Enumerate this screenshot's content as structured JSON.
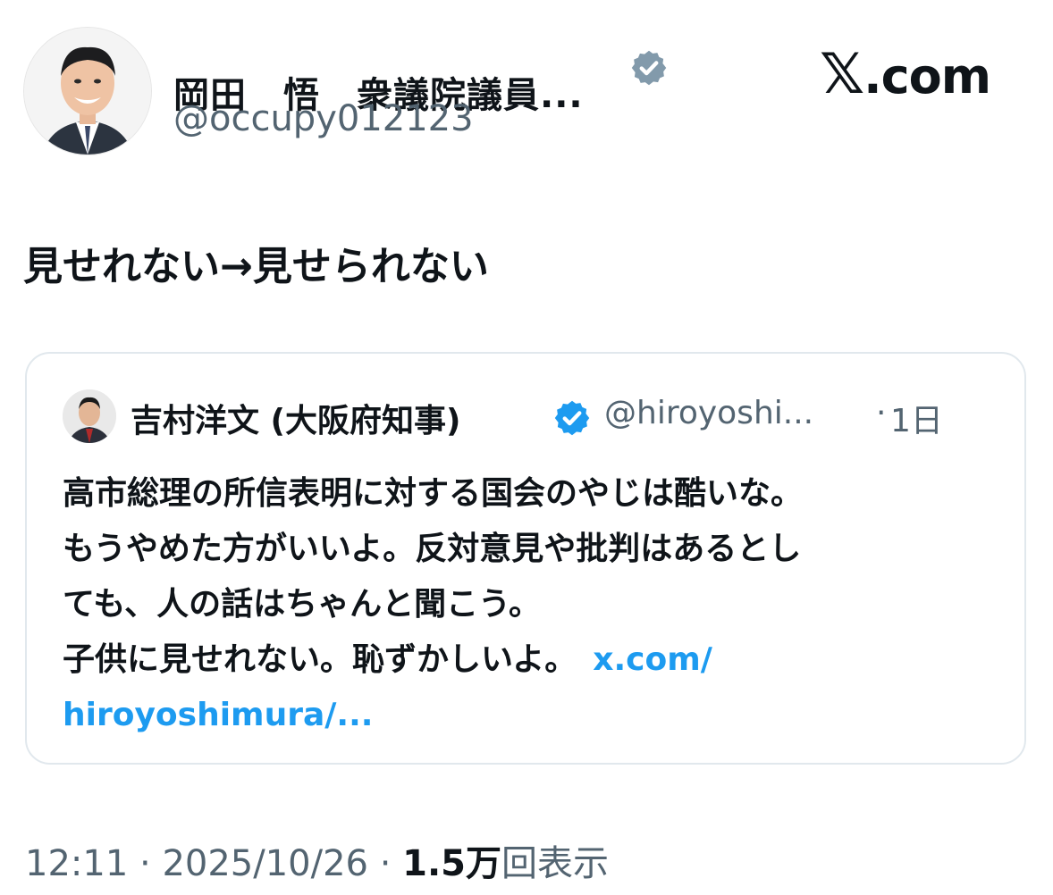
{
  "brand": {
    "logo_x": "𝕏",
    "logo_text": ".com"
  },
  "author": {
    "display_name": "岡田　悟　衆議院議員...",
    "handle": "@occupy012123",
    "verified_badge": "verified-gray-badge"
  },
  "tweet": {
    "text": "見せれない→見せられない"
  },
  "quoted": {
    "display_name": "吉村洋文 (大阪府知事)",
    "handle": "@hiroyoshi...",
    "separator": "·",
    "time": "1日",
    "lines": [
      "高市総理の所信表明に対する国会のやじは酷いな。",
      "もうやめた方がいいよ。反対意見や批判はあるとし",
      "ても、人の話はちゃんと聞こう。",
      "子供に見せれない。恥ずかしいよ。"
    ],
    "link_part1": "x.com/",
    "link_part2": "hiroyoshimura/..."
  },
  "meta": {
    "time": "12:11",
    "dot1": "·",
    "date": "2025/10/26",
    "dot2": "·",
    "views_count": "1.5万",
    "views_label": "回表示"
  },
  "colors": {
    "link": "#1d9bf0",
    "muted": "#536471",
    "verified_blue": "#1d9bf0",
    "verified_gray": "#829aab"
  }
}
